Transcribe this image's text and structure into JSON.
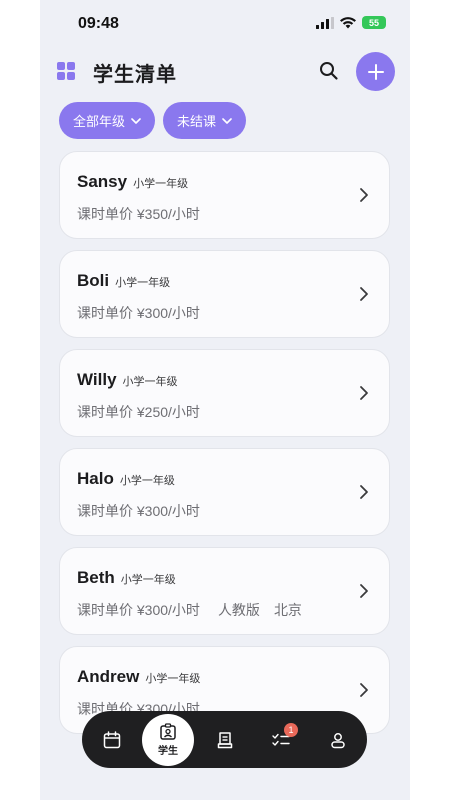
{
  "status_bar": {
    "time": "09:48",
    "battery": "55"
  },
  "header": {
    "title": "学生清单"
  },
  "filters": [
    {
      "label": "全部年级"
    },
    {
      "label": "未结课"
    }
  ],
  "students": [
    {
      "name": "Sansy",
      "grade": "小学一年级",
      "price": "课时单价 ¥350/小时",
      "extras": []
    },
    {
      "name": "Boli",
      "grade": "小学一年级",
      "price": "课时单价 ¥300/小时",
      "extras": []
    },
    {
      "name": "Willy",
      "grade": "小学一年级",
      "price": "课时单价 ¥250/小时",
      "extras": []
    },
    {
      "name": "Halo",
      "grade": "小学一年级",
      "price": "课时单价 ¥300/小时",
      "extras": []
    },
    {
      "name": "Beth",
      "grade": "小学一年级",
      "price": "课时单价 ¥300/小时",
      "extras": [
        "人教版",
        "北京"
      ]
    },
    {
      "name": "Andrew",
      "grade": "小学一年级",
      "price": "课时单价 ¥300/小时",
      "extras": []
    }
  ],
  "tabbar": {
    "active_label": "学生",
    "tasks_badge": "1",
    "icons": [
      "calendar-icon",
      "student-card-icon",
      "ledger-icon",
      "checklist-icon",
      "profile-icon"
    ]
  },
  "colors": {
    "accent": "#8a78ee",
    "badge": "#e9695a",
    "tabbar_bg": "#1f1f21",
    "battery": "#34c759",
    "background": "#eef0f6"
  }
}
